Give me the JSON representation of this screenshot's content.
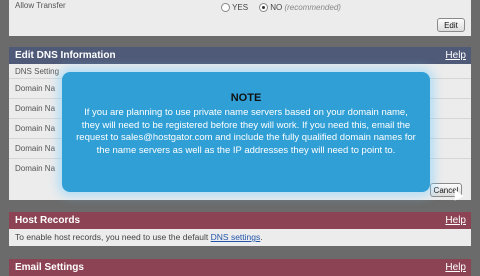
{
  "transfer_panel": {
    "label": "Allow Transfer",
    "options": [
      {
        "label": "YES",
        "selected": false
      },
      {
        "label": "NO",
        "selected": true
      }
    ],
    "recommended_note": "(recommended)",
    "edit_button": "Edit"
  },
  "dns_panel": {
    "title": "Edit DNS Information",
    "help": "Help",
    "rows": [
      "DNS Setting",
      "Domain Na",
      "Domain Na",
      "Domain Na",
      "Domain Na",
      "Domain Na"
    ],
    "cancel_button": "Cancel"
  },
  "note_dialog": {
    "title": "NOTE",
    "body": "If you are planning to use private name servers based on your domain name, they will need to be registered before they will work.  If you need this, email the request to sales@hostgator.com and include the fully qualified domain names for the name servers as well as the IP addresses they will need to point to."
  },
  "host_records": {
    "title": "Host Records",
    "help": "Help",
    "text_before": "To enable host records, you need to use the default ",
    "link": "DNS settings",
    "text_after": "."
  },
  "email_settings": {
    "title": "Email Settings",
    "help": "Help"
  },
  "colors": {
    "dns_header": "#4f5a78",
    "host_header": "#8c4455",
    "note_bg": "#2f9fd6"
  }
}
